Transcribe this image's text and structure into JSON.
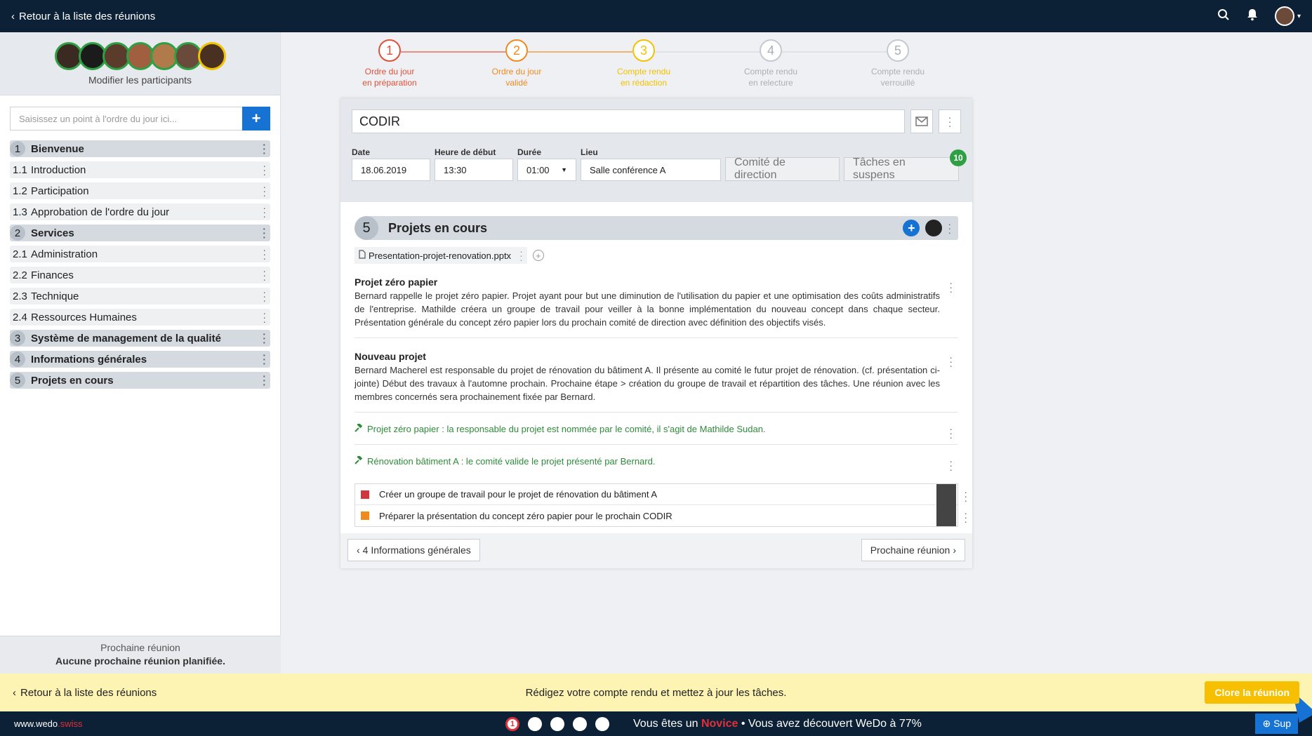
{
  "topbar": {
    "back_label": "Retour à la liste des réunions"
  },
  "sidebar": {
    "participants_label": "Modifier les participants",
    "add_placeholder": "Saisissez un point à l'ordre du jour ici...",
    "add_button": "+",
    "items": [
      {
        "num": "1",
        "label": "Bienvenue",
        "main": true
      },
      {
        "num": "1.1",
        "label": "Introduction",
        "main": false
      },
      {
        "num": "1.2",
        "label": "Participation",
        "main": false
      },
      {
        "num": "1.3",
        "label": "Approbation de l'ordre du jour",
        "main": false
      },
      {
        "num": "2",
        "label": "Services",
        "main": true
      },
      {
        "num": "2.1",
        "label": "Administration",
        "main": false
      },
      {
        "num": "2.2",
        "label": "Finances",
        "main": false
      },
      {
        "num": "2.3",
        "label": "Technique",
        "main": false
      },
      {
        "num": "2.4",
        "label": "Ressources Humaines",
        "main": false
      },
      {
        "num": "3",
        "label": "Système de management de la qualité",
        "main": true
      },
      {
        "num": "4",
        "label": "Informations générales",
        "main": true
      },
      {
        "num": "5",
        "label": "Projets en cours",
        "main": true
      }
    ],
    "next_meeting_label": "Prochaine réunion",
    "next_meeting_value": "Aucune prochaine réunion planifiée."
  },
  "stepper": [
    {
      "num": "1",
      "line1": "Ordre du jour",
      "line2": "en préparation",
      "color": "#e0503a"
    },
    {
      "num": "2",
      "line1": "Ordre du jour",
      "line2": "validé",
      "color": "#ef8a1f"
    },
    {
      "num": "3",
      "line1": "Compte rendu",
      "line2": "en rédaction",
      "color": "#f2c200"
    },
    {
      "num": "4",
      "line1": "Compte rendu",
      "line2": "en relecture",
      "color": "#c5cad0"
    },
    {
      "num": "5",
      "line1": "Compte rendu",
      "line2": "verrouillé",
      "color": "#c5cad0"
    }
  ],
  "meeting": {
    "title": "CODIR",
    "date_label": "Date",
    "date": "18.06.2019",
    "start_label": "Heure de début",
    "start": "13:30",
    "duration_label": "Durée",
    "duration": "01:00",
    "place_label": "Lieu",
    "place": "Salle conférence A",
    "group": "Comité de direction",
    "pending": "Tâches en suspens",
    "pending_count": "10"
  },
  "section": {
    "num": "5",
    "title": "Projets en cours",
    "attachment": "Presentation-projet-renovation.pptx",
    "notes": [
      {
        "title": "Projet zéro papier",
        "text": "Bernard rappelle le projet zéro papier. Projet ayant pour but une diminution de l'utilisation du papier et une optimisation des coûts administratifs de l'entreprise. Mathilde créera un groupe de travail pour veiller à la bonne implémentation du nouveau concept dans chaque secteur. Présentation générale du concept zéro papier lors du prochain comité de direction avec définition des objectifs visés."
      },
      {
        "title": "Nouveau projet",
        "text": "Bernard Macherel est responsable du projet de rénovation du bâtiment A. Il présente au comité le futur projet de rénovation. (cf. présentation ci-jointe) Début des travaux à l'automne prochain. Prochaine étape > création du groupe de travail et répartition des tâches. Une réunion avec les membres concernés sera prochainement fixée par Bernard."
      }
    ],
    "decisions": [
      "Projet zéro papier : la responsable du projet est nommée par le comité, il s'agit de Mathilde Sudan.",
      "Rénovation bâtiment A : le comité valide le projet présenté par Bernard."
    ],
    "tasks": [
      {
        "label": "Créer un groupe de travail pour le projet de rénovation du bâtiment A",
        "color": "#d0363f"
      },
      {
        "label": "Préparer la présentation du concept zéro papier pour le prochain CODIR",
        "color": "#ef8a1f"
      }
    ]
  },
  "footer_nav": {
    "prev": "4 Informations générales",
    "next": "Prochaine réunion"
  },
  "yellowbar": {
    "back": "Retour à la liste des réunions",
    "message": "Rédigez votre compte rendu et mettez à jour les tâches.",
    "close": "Clore la réunion"
  },
  "bottombar": {
    "brand_main": "www.wedo",
    "brand_ext": ".swiss",
    "progress_prefix": "Vous êtes un ",
    "level": "Novice",
    "progress_suffix": " • Vous avez découvert WeDo à 77%",
    "step_badge": "1",
    "support": "Sup"
  }
}
